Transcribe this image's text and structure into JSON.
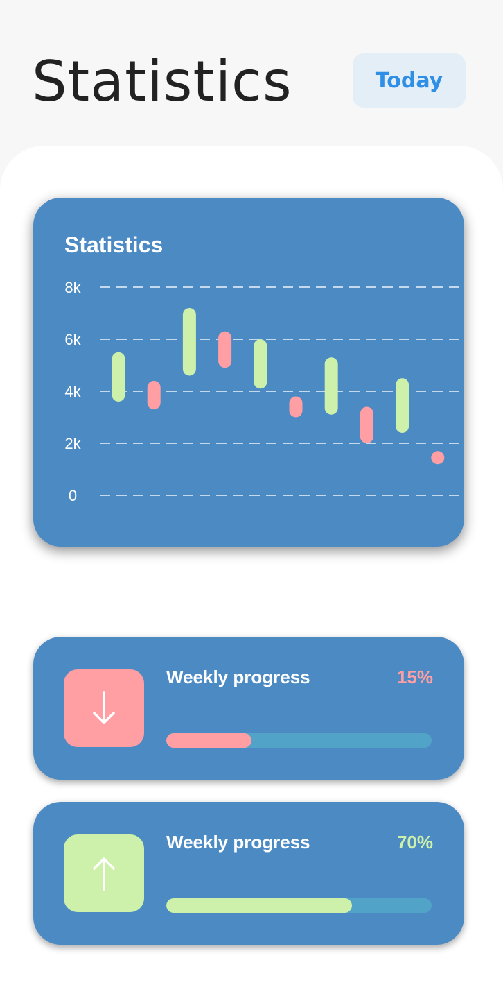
{
  "header": {
    "title": "Statistics",
    "period_button": "Today"
  },
  "chart_card": {
    "title": "Statistics"
  },
  "chart_data": {
    "type": "candlestick",
    "title": "Statistics",
    "y_ticks": [
      "8k",
      "6k",
      "4k",
      "2k",
      "0"
    ],
    "y_tick_values": [
      8000,
      6000,
      4000,
      2000,
      0
    ],
    "ylim": [
      0,
      8000
    ],
    "grid": true,
    "colors": {
      "up": "#cdf0aa",
      "down": "#ff9fa4"
    },
    "series": [
      {
        "direction": "up",
        "low": 3600,
        "high": 5500
      },
      {
        "direction": "down",
        "low": 3300,
        "high": 4400
      },
      {
        "direction": "up",
        "low": 4600,
        "high": 7200
      },
      {
        "direction": "down",
        "low": 4900,
        "high": 6300
      },
      {
        "direction": "up",
        "low": 4100,
        "high": 6000
      },
      {
        "direction": "down",
        "low": 3000,
        "high": 3800
      },
      {
        "direction": "up",
        "low": 3100,
        "high": 5300
      },
      {
        "direction": "down",
        "low": 2000,
        "high": 3400
      },
      {
        "direction": "up",
        "low": 2400,
        "high": 4500
      },
      {
        "direction": "down",
        "low": 1300,
        "high": 1700
      }
    ]
  },
  "progress_cards": [
    {
      "label": "Weekly progress",
      "percent_text": "15%",
      "fill_fraction": 0.32,
      "direction_icon": "arrow-down-icon",
      "accent": "#ff9fa4"
    },
    {
      "label": "Weekly progress",
      "percent_text": "70%",
      "fill_fraction": 0.7,
      "direction_icon": "arrow-up-icon",
      "accent": "#cdf0aa"
    }
  ]
}
